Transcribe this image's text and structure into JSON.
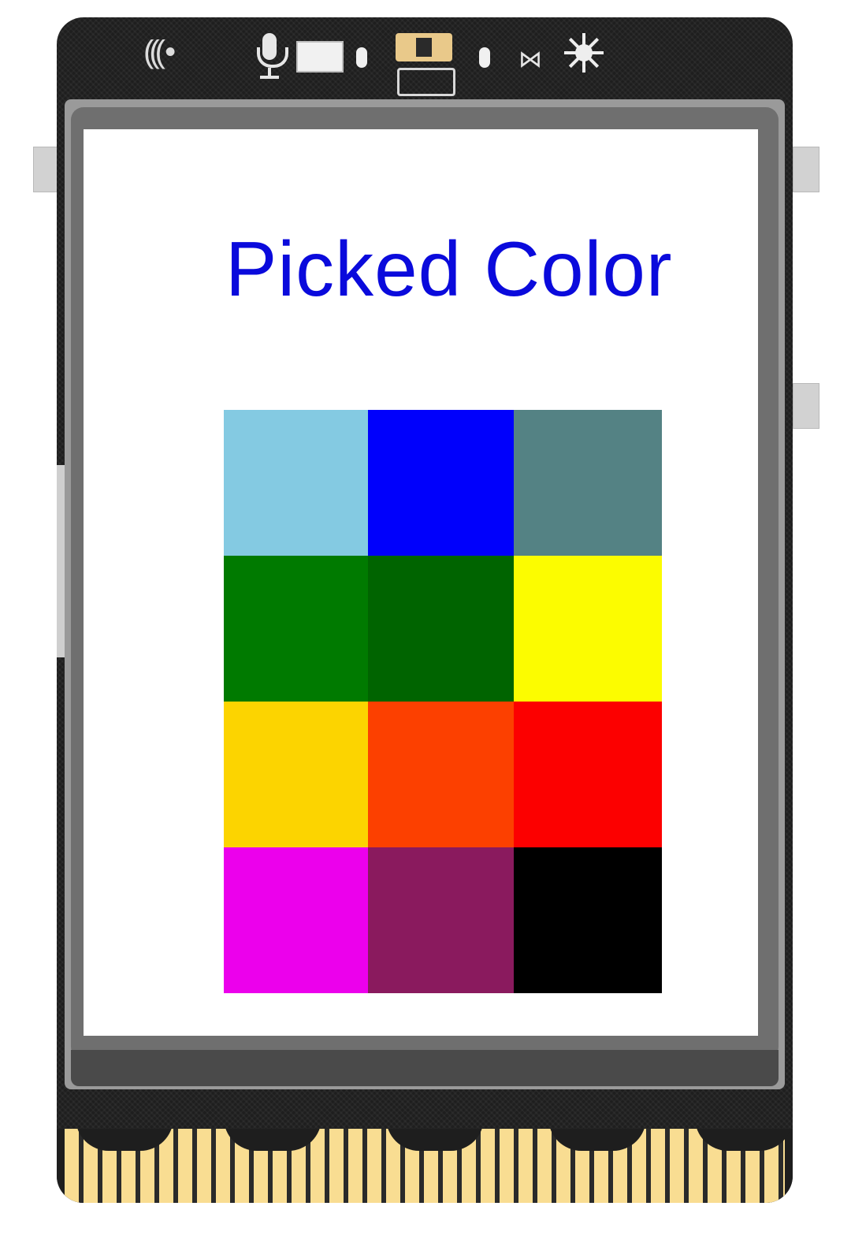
{
  "screen": {
    "title": "Picked Color",
    "title_color": "#0a0adc",
    "background": "#ffffff"
  },
  "palette": [
    "#84cae2",
    "#0000fc",
    "#548284",
    "#007a00",
    "#006400",
    "#fcfc00",
    "#fcd400",
    "#fc4000",
    "#fc0000",
    "#ec00ec",
    "#8a1a5e",
    "#000000"
  ],
  "device": {
    "body_color": "#1e1e1e",
    "pad_color": "#f9dd92",
    "sensors": [
      "wireless-signal-icon",
      "microphone-icon",
      "light-sensor",
      "rgb-led",
      "buzzer-icon",
      "brightness-icon"
    ]
  }
}
